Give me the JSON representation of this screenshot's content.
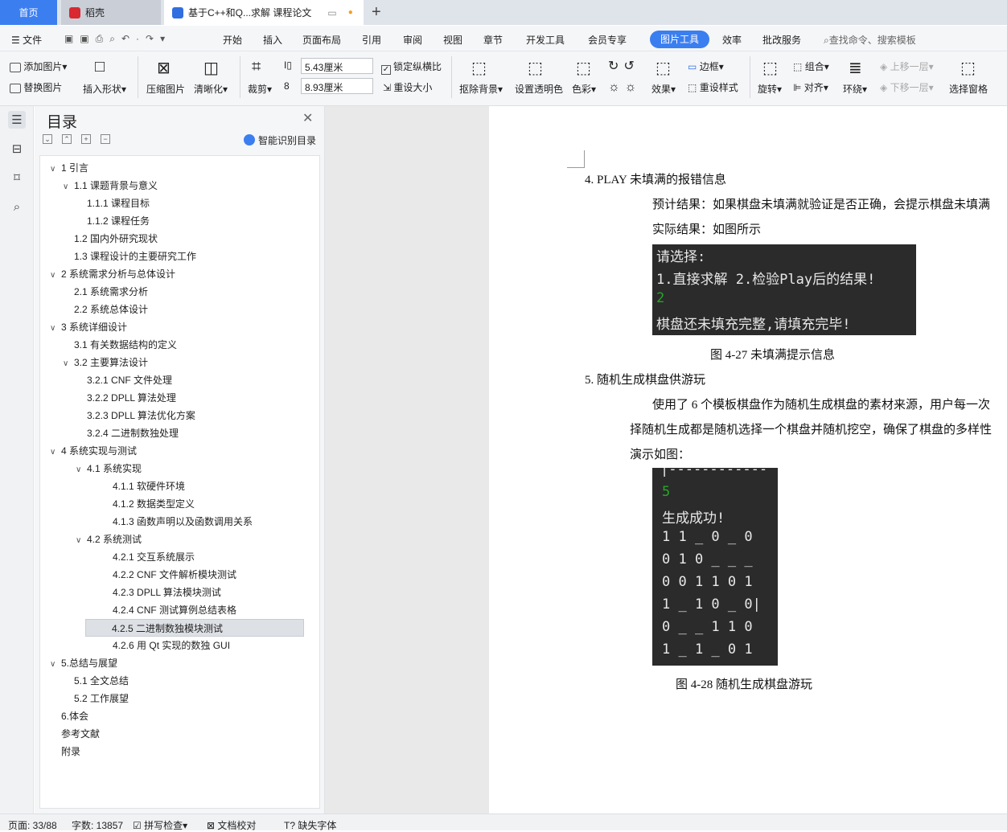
{
  "tabs": {
    "home": "首页",
    "shell": "稻壳",
    "doc": "基于C++和Q...求解 课程论文"
  },
  "menu": {
    "file": "文件",
    "items": [
      "开始",
      "插入",
      "页面布局",
      "引用",
      "审阅",
      "视图",
      "章节",
      "开发工具",
      "会员专享"
    ],
    "active": "图片工具",
    "after": [
      "效率",
      "批改服务"
    ],
    "search": "查找命令、搜索模板"
  },
  "toolbar": {
    "add_picture": "添加图片",
    "replace_picture": "替换图片",
    "insert_shape": "插入形状",
    "compress": "压缩图片",
    "clarify": "清晰化",
    "crop": "裁剪",
    "height": "5.43厘米",
    "width": "8.93厘米",
    "lock_ratio": "锁定纵横比",
    "reset_size": "重设大小",
    "remove_bg": "抠除背景",
    "set_transparent": "设置透明色",
    "color": "色彩",
    "effect": "效果",
    "border": "边框",
    "reset_style": "重设样式",
    "rotate": "旋转",
    "group": "组合",
    "align": "对齐",
    "wrap": "环绕",
    "bring_forward": "上移一层",
    "send_backward": "下移一层",
    "selection_pane": "选择窗格"
  },
  "panel": {
    "title": "目录",
    "smart": "智能识别目录",
    "toc": [
      {
        "label": "1  引言",
        "level": 0,
        "arrow": "down"
      },
      {
        "label": "1.1  课题背景与意义",
        "level": 1,
        "arrow": "down"
      },
      {
        "label": "1.1.1  课程目标",
        "level": 2,
        "arrow": ""
      },
      {
        "label": "1.1.2  课程任务",
        "level": 2,
        "arrow": ""
      },
      {
        "label": "1.2  国内外研究现状",
        "level": 1,
        "arrow": ""
      },
      {
        "label": "1.3  课程设计的主要研究工作",
        "level": 1,
        "arrow": ""
      },
      {
        "label": "2  系统需求分析与总体设计",
        "level": 0,
        "arrow": "down"
      },
      {
        "label": "2.1  系统需求分析",
        "level": 1,
        "arrow": ""
      },
      {
        "label": "2.2  系统总体设计",
        "level": 1,
        "arrow": ""
      },
      {
        "label": "3  系统详细设计",
        "level": 0,
        "arrow": "down"
      },
      {
        "label": "3.1  有关数据结构的定义",
        "level": 1,
        "arrow": ""
      },
      {
        "label": "3.2 主要算法设计",
        "level": 1,
        "arrow": "down"
      },
      {
        "label": "3.2.1 CNF 文件处理",
        "level": 2,
        "arrow": ""
      },
      {
        "label": "3.2.2 DPLL 算法处理",
        "level": 2,
        "arrow": ""
      },
      {
        "label": "3.2.3 DPLL 算法优化方案",
        "level": 2,
        "arrow": ""
      },
      {
        "label": "3.2.4  二进制数独处理",
        "level": 2,
        "arrow": ""
      },
      {
        "label": "4  系统实现与测试",
        "level": 0,
        "arrow": "down"
      },
      {
        "label": "4.1  系统实现",
        "level": 2,
        "arrow": "down"
      },
      {
        "label": "4.1.1  软硬件环境",
        "level": 3,
        "arrow": ""
      },
      {
        "label": "4.1.2  数据类型定义",
        "level": 3,
        "arrow": ""
      },
      {
        "label": "4.1.3  函数声明以及函数调用关系",
        "level": 3,
        "arrow": ""
      },
      {
        "label": "4.2  系统测试",
        "level": 2,
        "arrow": "down"
      },
      {
        "label": "4.2.1  交互系统展示",
        "level": 3,
        "arrow": ""
      },
      {
        "label": "4.2.2 CNF 文件解析模块测试",
        "level": 3,
        "arrow": ""
      },
      {
        "label": "4.2.3 DPLL 算法模块测试",
        "level": 3,
        "arrow": ""
      },
      {
        "label": "4.2.4 CNF 测试算例总结表格",
        "level": 3,
        "arrow": ""
      },
      {
        "label": "4.2.5  二进制数独模块测试",
        "level": 3,
        "arrow": "",
        "selected": true
      },
      {
        "label": "4.2.6 用 Qt 实现的数独 GUI",
        "level": 3,
        "arrow": ""
      },
      {
        "label": "5.总结与展望",
        "level": 0,
        "arrow": "down"
      },
      {
        "label": "5.1  全文总结",
        "level": 1,
        "arrow": ""
      },
      {
        "label": "5.2 工作展望",
        "level": 1,
        "arrow": ""
      },
      {
        "label": "6.体会",
        "level": 0,
        "arrow": ""
      },
      {
        "label": "参考文献",
        "level": 0,
        "arrow": ""
      },
      {
        "label": "附录",
        "level": 0,
        "arrow": ""
      }
    ]
  },
  "document": {
    "item4": "4.  PLAY 未填满的报错信息",
    "expected": "预计结果：如果棋盘未填满就验证是否正确，会提示棋盘未填满",
    "actual": "实际结果：如图所示",
    "term1": [
      "请选择:",
      "1.直接求解      2.检验Play后的结果!",
      "2",
      "棋盘还未填充完整,请填充完毕!"
    ],
    "fig27": "图 4-27  未填满提示信息",
    "item5": "5.  随机生成棋盘供游玩",
    "para1": "使用了 6 个模板棋盘作为随机生成棋盘的素材来源，用户每一次",
    "para2": "择随机生成都是随机选择一个棋盘并随机挖空，确保了棋盘的多样性",
    "para3": "演示如图：",
    "term2": [
      "|------------",
      "5",
      "生成成功!",
      "1 1 _ 0 _ 0",
      "0 1 0 _ _ _",
      "0 0 1 1 0 1",
      "1 _ 1 0 _ 0|",
      "0 _ _ 1 1 0",
      "1 _ 1 _ 0 1"
    ],
    "fig28": "图 4-28  随机生成棋盘游玩"
  },
  "status": {
    "page": "页面: 33/88",
    "words": "字数: 13857",
    "spell": "拼写检查",
    "proof": "文档校对",
    "font_missing": "缺失字体"
  },
  "colors": {
    "accent": "#3b7ef0",
    "terminal": "#2b2b2b",
    "green": "#26a626"
  }
}
